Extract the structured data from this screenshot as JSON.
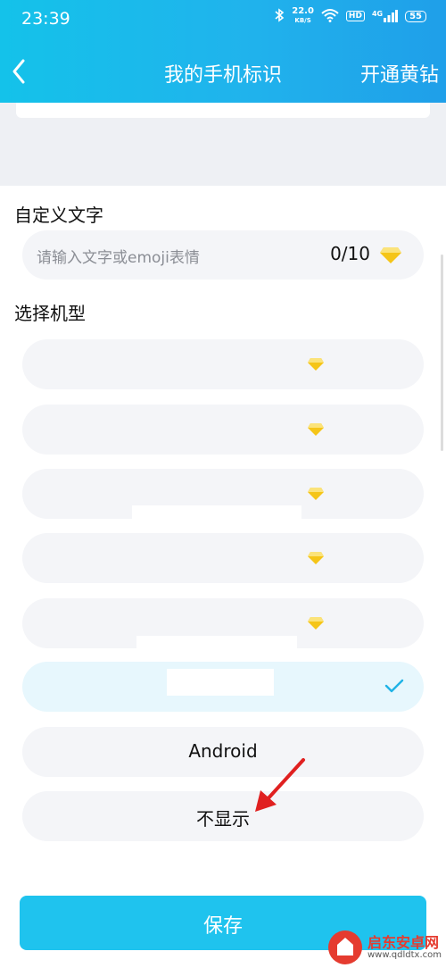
{
  "status_bar": {
    "time": "23:39",
    "net_speed_value": "22.0",
    "net_speed_unit": "KB/S",
    "hd": "HD",
    "network": "4G",
    "battery": "55"
  },
  "header": {
    "title": "我的手机标识",
    "vip_link": "开通黄钻"
  },
  "custom_text": {
    "label": "自定义文字",
    "placeholder": "请输入文字或emoji表情",
    "counter": "0/10"
  },
  "model_section": {
    "label": "选择机型",
    "options": [
      {
        "label": "",
        "premium": true
      },
      {
        "label": "",
        "premium": true
      },
      {
        "label": "",
        "premium": true
      },
      {
        "label": "",
        "premium": true
      },
      {
        "label": "",
        "premium": true
      },
      {
        "label": "",
        "selected": true
      },
      {
        "label": "Android"
      },
      {
        "label": "不显示"
      }
    ]
  },
  "save_label": "保存",
  "watermark": {
    "title": "启东安卓网",
    "url": "www.qdldtx.com"
  },
  "colors": {
    "accent": "#1fc3ee",
    "diamond": "#f5c518",
    "selected_bg": "#e7f7fd",
    "arrow": "#e02020"
  }
}
